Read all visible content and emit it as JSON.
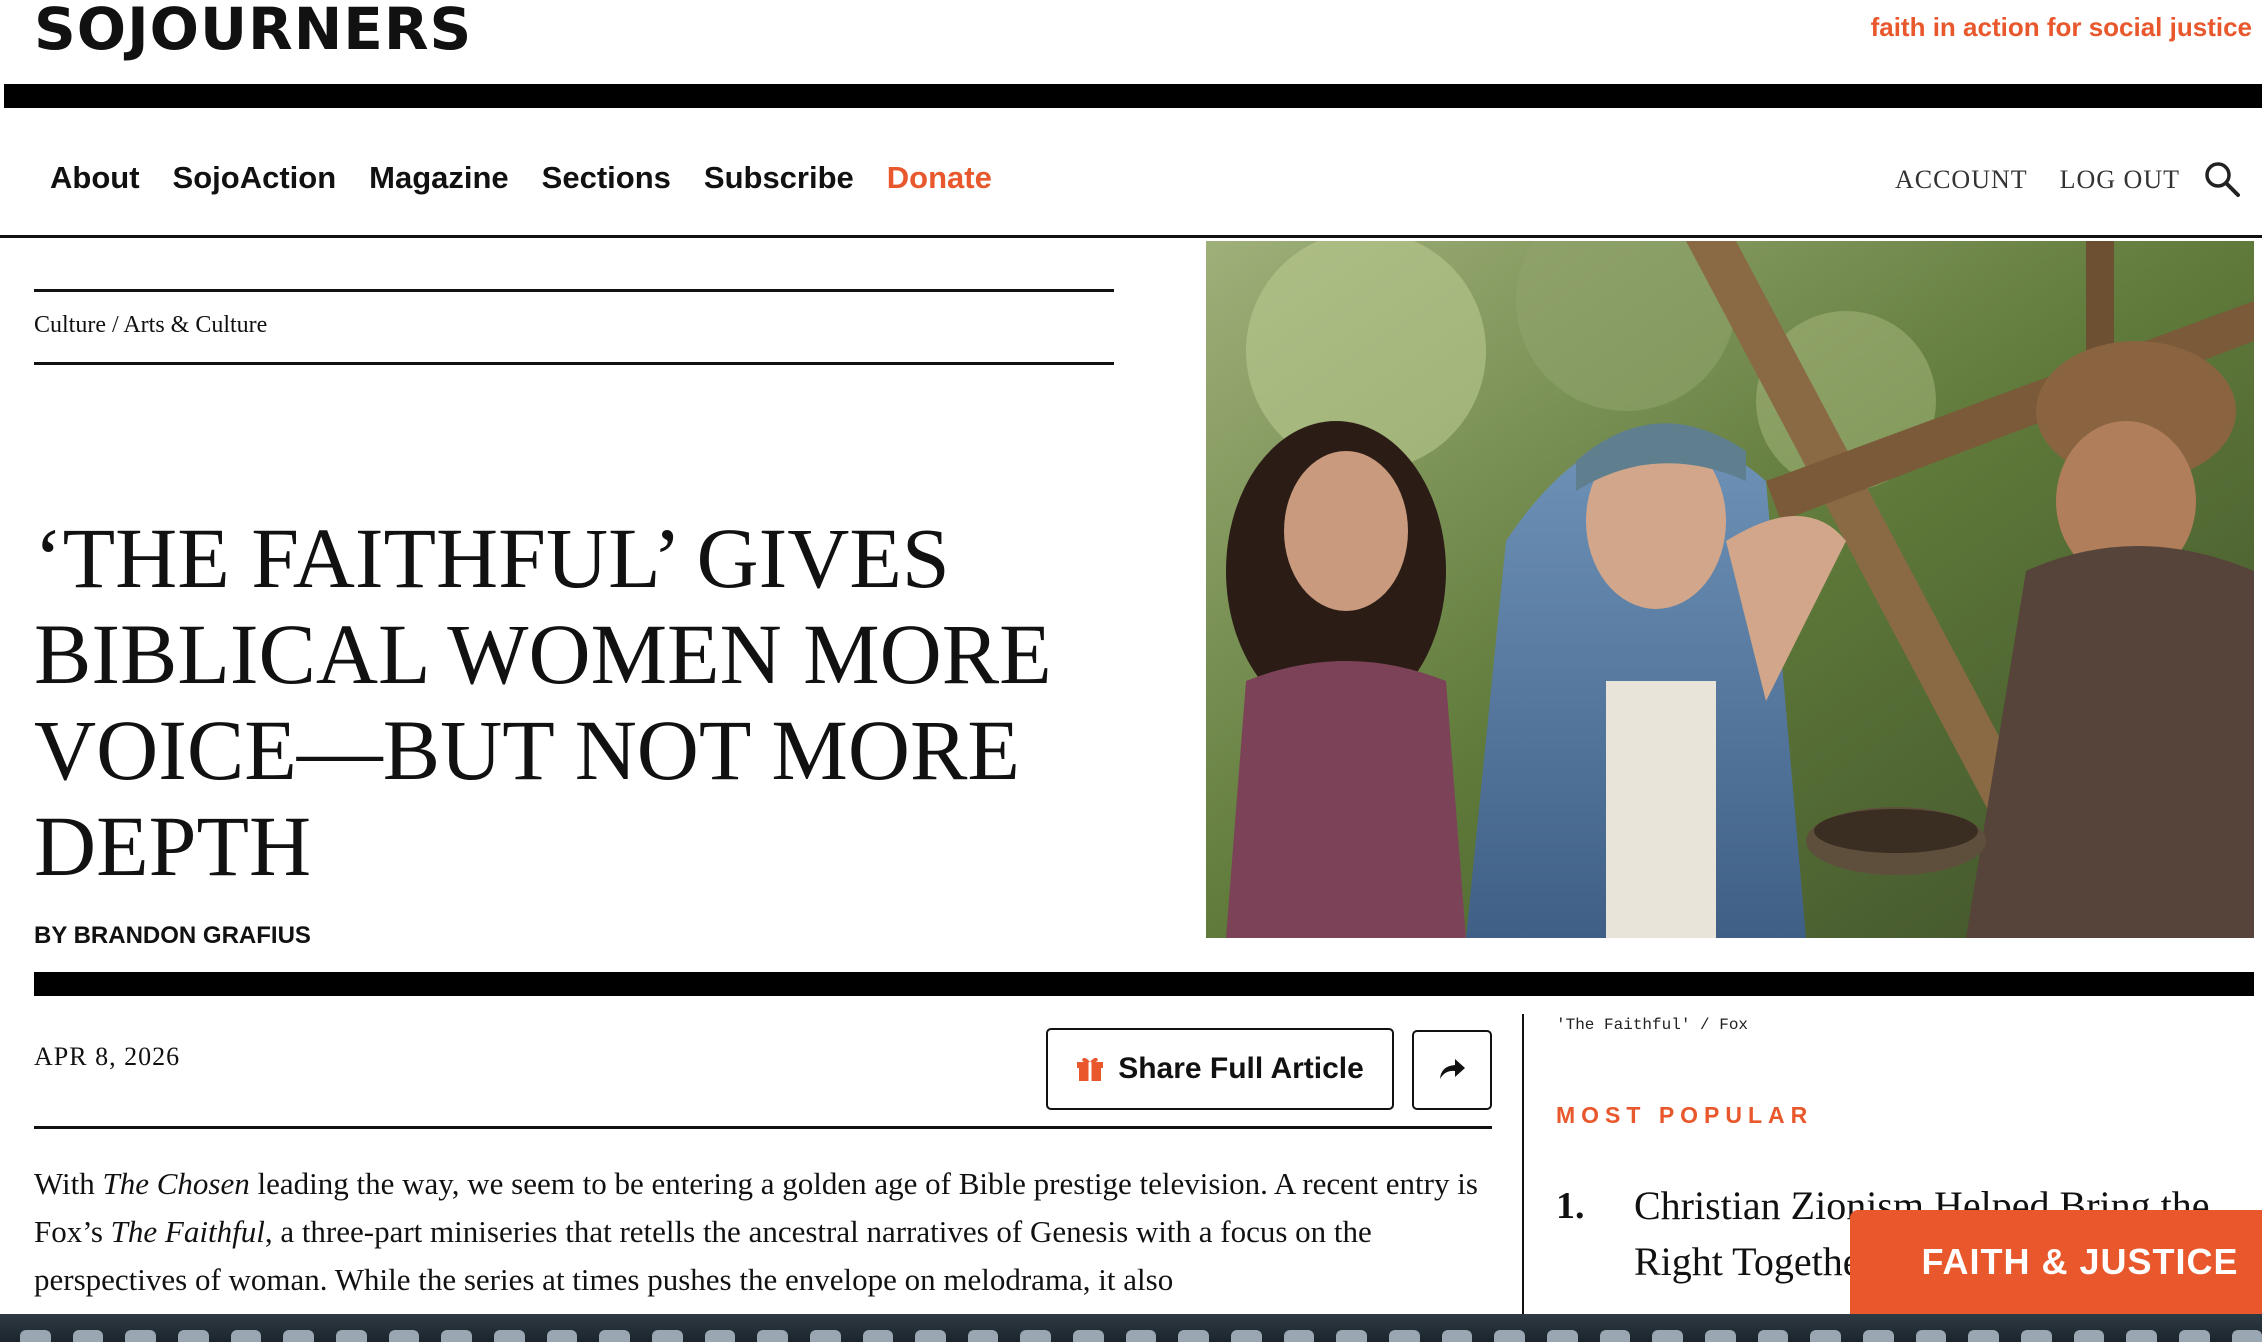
{
  "header": {
    "logo": "SOJOURNERS",
    "tagline": "faith in action for social justice"
  },
  "nav": {
    "items": [
      {
        "label": "About"
      },
      {
        "label": "SojoAction"
      },
      {
        "label": "Magazine"
      },
      {
        "label": "Sections"
      },
      {
        "label": "Subscribe"
      },
      {
        "label": "Donate"
      }
    ],
    "account": "ACCOUNT",
    "logout": "LOG OUT",
    "search_icon": "search-icon"
  },
  "article": {
    "breadcrumb": "Culture / Arts & Culture",
    "title": "‘THE FAITHFUL’ GIVES BIBLICAL WOMEN MORE VOICE—BUT NOT MORE DEPTH",
    "byline": "BY BRANDON GRAFIUS",
    "date": "APR 8, 2026",
    "share_label": "Share Full Article",
    "share_icon": "gift-icon",
    "forward_icon": "share-arrow-icon",
    "image_caption": "'The Faithful' / Fox",
    "body": {
      "p1_a": "With ",
      "p1_em1": "The Chosen",
      "p1_b": " leading the way, we seem to be entering a golden age of Bible prestige television. A recent entry is Fox’s ",
      "p1_em2": "The Faithful",
      "p1_c": ", a three-part miniseries that retells the ancestral narratives of Genesis with a focus on the perspectives of woman. While the series at times pushes the envelope on melodrama, it also"
    }
  },
  "sidebar": {
    "heading": "MOST POPULAR",
    "items": [
      {
        "number": "1.",
        "title": "Christian Zionism Helped Bring the Right Together... Apart"
      }
    ]
  },
  "badge": {
    "label": "FAITH & JUSTICE"
  },
  "colors": {
    "accent": "#e8582c",
    "ink": "#111111"
  }
}
